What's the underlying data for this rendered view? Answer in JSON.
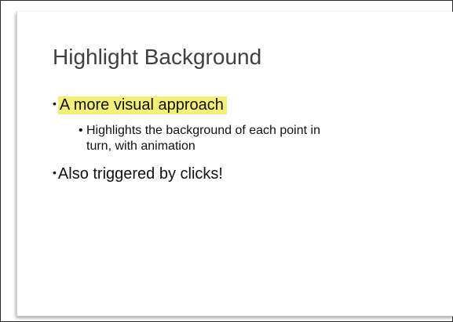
{
  "slide": {
    "title": "Highlight Background",
    "bullets": [
      {
        "text": "A more visual approach",
        "highlighted": true,
        "highlight_color": "#f3f07a",
        "sub_bullets": [
          {
            "text": "Highlights the background of each point in\nturn, with animation"
          }
        ]
      },
      {
        "text": "Also triggered by clicks!",
        "highlighted": false
      }
    ],
    "bullet_glyph": "•"
  }
}
